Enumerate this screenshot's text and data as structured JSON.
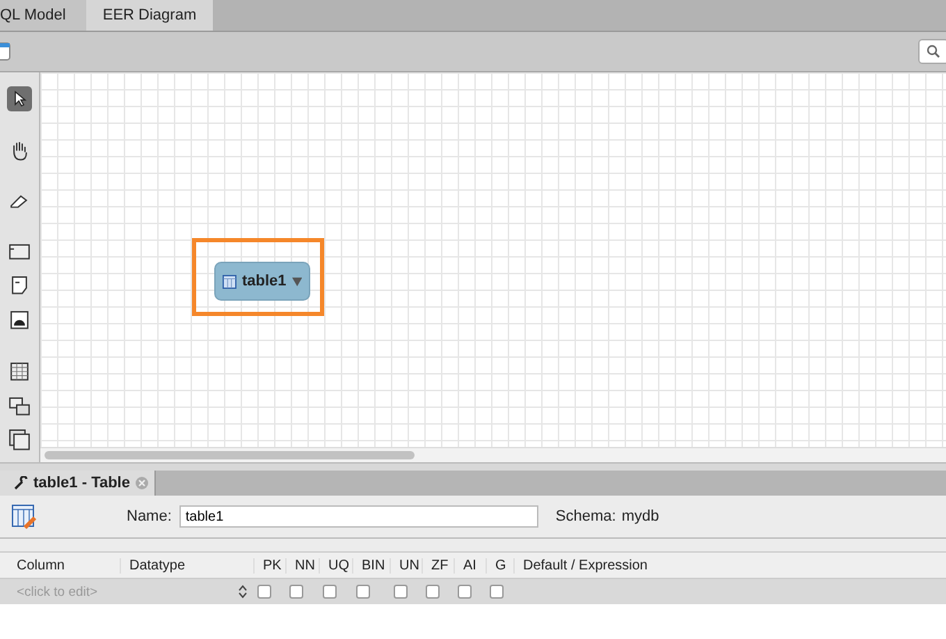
{
  "tabs": [
    {
      "label": "QL Model",
      "selected": false
    },
    {
      "label": "EER Diagram",
      "selected": true
    }
  ],
  "canvas": {
    "node": {
      "name": "table1",
      "highlighted": true
    }
  },
  "editor": {
    "tab": {
      "label": "table1 - Table"
    },
    "name_label": "Name:",
    "name_value": "table1",
    "schema_label": "Schema:",
    "schema_value": "mydb",
    "columns": [
      "Column",
      "Datatype",
      "PK",
      "NN",
      "UQ",
      "BIN",
      "UN",
      "ZF",
      "AI",
      "G",
      "Default / Expression"
    ],
    "rows": [
      {
        "column_placeholder": "<click to edit>",
        "flags": [
          {
            "checked": false
          },
          {
            "checked": false
          },
          {
            "checked": false
          },
          {
            "checked": false
          },
          {
            "checked": false
          },
          {
            "checked": false
          },
          {
            "checked": false
          },
          {
            "checked": false
          }
        ]
      }
    ]
  }
}
